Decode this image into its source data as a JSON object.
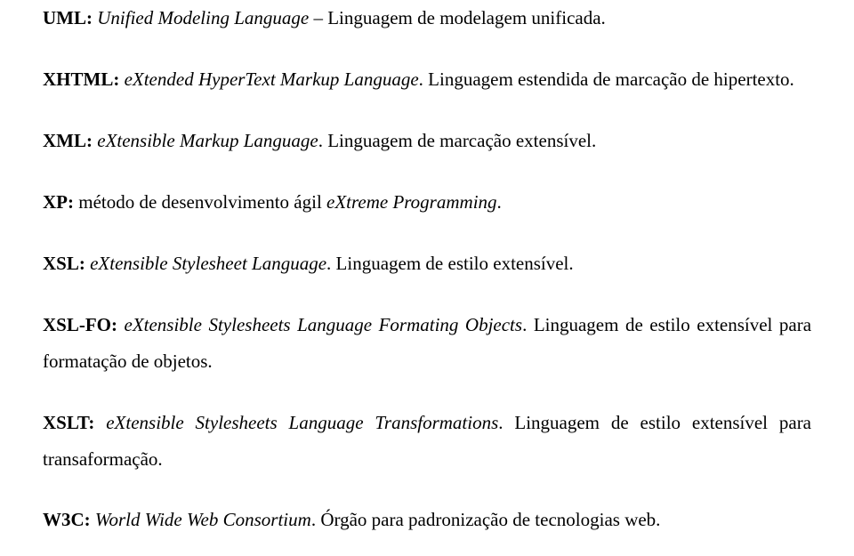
{
  "entries": [
    {
      "abbr": "UML:",
      "expansion": "Unified Modeling Language",
      "connector": " – ",
      "translation": "Linguagem de modelagem unificada."
    },
    {
      "abbr": "XHTML:",
      "expansion": "eXtended HyperText Markup Language",
      "connector": ". ",
      "translation": "Linguagem estendida de marcação de hipertexto."
    },
    {
      "abbr": "XML:",
      "expansion": "eXtensible Markup Language",
      "connector": ". ",
      "translation": "Linguagem de marcação extensível."
    },
    {
      "abbr": "XP:",
      "expansion": "eXtreme Programming",
      "connector": ".",
      "translation": "",
      "prefix": "método de desenvolvimento ágil "
    },
    {
      "abbr": "XSL:",
      "expansion": "eXtensible Stylesheet Language",
      "connector": ". ",
      "translation": "Linguagem de estilo extensível."
    },
    {
      "abbr": "XSL-FO:",
      "expansion": "eXtensible Stylesheets Language Formating Objects",
      "connector": ". ",
      "translation": "Linguagem de estilo extensível para formatação de objetos."
    },
    {
      "abbr": "XSLT:",
      "expansion": "eXtensible Stylesheets Language Transformations",
      "connector": ". ",
      "translation": "Linguagem de estilo extensível para transaformação."
    },
    {
      "abbr": "W3C:",
      "expansion": "World Wide Web Consortium",
      "connector": ". ",
      "translation": "Órgão para padronização de tecnologias web."
    }
  ]
}
